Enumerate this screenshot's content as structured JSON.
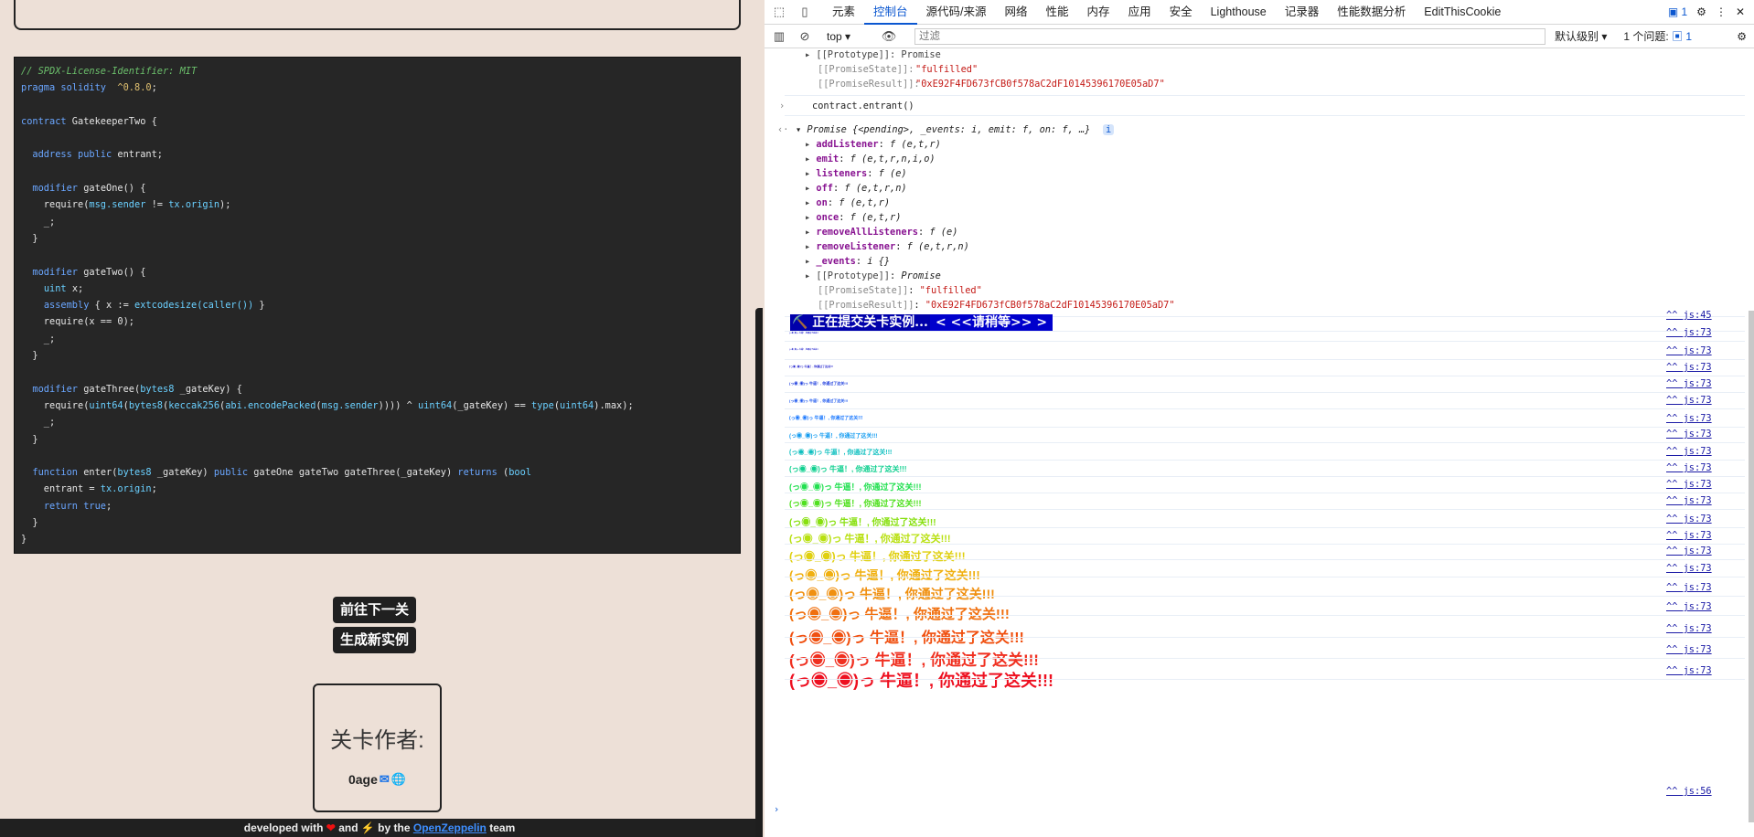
{
  "code": {
    "lines": [
      [
        [
          "cm",
          "// SPDX-License-Identifier: MIT"
        ]
      ],
      [
        [
          "kw",
          "pragma solidity"
        ],
        [
          "",
          "  "
        ],
        [
          "st",
          "^0.8.0"
        ],
        [
          "",
          ";"
        ]
      ],
      [
        [
          "",
          ""
        ]
      ],
      [
        [
          "kw",
          "contract"
        ],
        [
          "",
          " GatekeeperTwo {"
        ]
      ],
      [
        [
          "",
          ""
        ]
      ],
      [
        [
          "",
          "  "
        ],
        [
          "kw",
          "address public"
        ],
        [
          "",
          " entrant;"
        ]
      ],
      [
        [
          "",
          ""
        ]
      ],
      [
        [
          "",
          "  "
        ],
        [
          "kw",
          "modifier"
        ],
        [
          "",
          " gateOne() {"
        ]
      ],
      [
        [
          "",
          "    require("
        ],
        [
          "tp",
          "msg.sender"
        ],
        [
          "",
          " != "
        ],
        [
          "tp",
          "tx.origin"
        ],
        [
          "",
          ");"
        ]
      ],
      [
        [
          "",
          "    _;"
        ]
      ],
      [
        [
          "",
          "  }"
        ]
      ],
      [
        [
          "",
          ""
        ]
      ],
      [
        [
          "",
          "  "
        ],
        [
          "kw",
          "modifier"
        ],
        [
          "",
          " gateTwo() {"
        ]
      ],
      [
        [
          "",
          "    "
        ],
        [
          "tp",
          "uint"
        ],
        [
          "",
          " x;"
        ]
      ],
      [
        [
          "",
          "    "
        ],
        [
          "kw",
          "assembly"
        ],
        [
          "",
          " { x := "
        ],
        [
          "tp",
          "extcodesize(caller())"
        ],
        [
          "",
          " }"
        ]
      ],
      [
        [
          "",
          "    require(x == 0);"
        ]
      ],
      [
        [
          "",
          "    _;"
        ]
      ],
      [
        [
          "",
          "  }"
        ]
      ],
      [
        [
          "",
          ""
        ]
      ],
      [
        [
          "",
          "  "
        ],
        [
          "kw",
          "modifier"
        ],
        [
          "",
          " gateThree("
        ],
        [
          "tp",
          "bytes8"
        ],
        [
          "",
          " _gateKey) {"
        ]
      ],
      [
        [
          "",
          "    require("
        ],
        [
          "tp",
          "uint64"
        ],
        [
          "",
          "("
        ],
        [
          "tp",
          "bytes8"
        ],
        [
          "",
          "("
        ],
        [
          "tp",
          "keccak256"
        ],
        [
          "",
          "("
        ],
        [
          "tp",
          "abi.encodePacked"
        ],
        [
          "",
          "("
        ],
        [
          "tp",
          "msg.sender"
        ],
        [
          "",
          ")))) ^ "
        ],
        [
          "tp",
          "uint64"
        ],
        [
          "",
          "(_gateKey) == "
        ],
        [
          "tp",
          "type"
        ],
        [
          "",
          "("
        ],
        [
          "tp",
          "uint64"
        ],
        [
          "",
          ").max);"
        ]
      ],
      [
        [
          "",
          "    _;"
        ]
      ],
      [
        [
          "",
          "  }"
        ]
      ],
      [
        [
          "",
          ""
        ]
      ],
      [
        [
          "",
          "  "
        ],
        [
          "kw",
          "function"
        ],
        [
          "",
          " enter("
        ],
        [
          "tp",
          "bytes8"
        ],
        [
          "",
          " _gateKey) "
        ],
        [
          "kw",
          "public"
        ],
        [
          "",
          " gateOne gateTwo gateThree(_gateKey) "
        ],
        [
          "kw",
          "returns"
        ],
        [
          "",
          " ("
        ],
        [
          "tp",
          "bool"
        ],
        [
          ") {"
        ]
      ],
      [
        [
          "",
          "    entrant = "
        ],
        [
          "tp",
          "tx.origin"
        ],
        [
          "",
          ";"
        ]
      ],
      [
        [
          "",
          "    "
        ],
        [
          "kw",
          "return true"
        ],
        [
          "",
          ";"
        ]
      ],
      [
        [
          "",
          "  }"
        ]
      ],
      [
        [
          "",
          "}"
        ]
      ]
    ]
  },
  "buttons": {
    "next": "前往下一关",
    "new_instance": "生成新实例"
  },
  "author": {
    "title": "关卡作者:",
    "name": "0age"
  },
  "footer": {
    "pre": "developed with",
    "and": "and",
    "by": "by the",
    "link": "OpenZeppelin",
    "post": "team"
  },
  "devtools": {
    "tabs": [
      "元素",
      "控制台",
      "源代码/来源",
      "网络",
      "性能",
      "内存",
      "应用",
      "安全",
      "Lighthouse",
      "记录器",
      "性能数据分析",
      "EditThisCookie"
    ],
    "active_tab": "控制台",
    "issue_badge": "1",
    "context": "top",
    "filter_placeholder": "过滤",
    "level": "默认级别",
    "issues": "1 个问题:",
    "issues_count": "1"
  },
  "console": {
    "top_block": [
      "[[Prototype]]: Promise",
      "[[PromiseState]]: \"fulfilled\"",
      "[[PromiseResult]]: \"0xE92F4FD673fCB0f578aC2dF10145396170E05aD7\""
    ],
    "command": "contract.entrant()",
    "promise_header": "Promise  {<pending>, _events: i, emit: f, on: f, …}",
    "props": [
      {
        "k": "addListener",
        "v": "f (e,t,r)"
      },
      {
        "k": "emit",
        "v": "f (e,t,r,n,i,o)"
      },
      {
        "k": "listeners",
        "v": "f (e)"
      },
      {
        "k": "off",
        "v": "f (e,t,r,n)"
      },
      {
        "k": "on",
        "v": "f (e,t,r)"
      },
      {
        "k": "once",
        "v": "f (e,t,r)"
      },
      {
        "k": "removeAllListeners",
        "v": "f (e)"
      },
      {
        "k": "removeListener",
        "v": "f (e,t,r,n)"
      },
      {
        "k": "_events",
        "v": "i  {}"
      },
      {
        "k": "[[Prototype]]",
        "v": "Promise"
      },
      {
        "k": "[[PromiseState]]",
        "v": "\"fulfilled\""
      },
      {
        "k": "[[PromiseResult]]",
        "v": "\"0xE92F4FD673fCB0f578aC2dF10145396170E05aD7\""
      }
    ],
    "submit_msg_a": "⛏️ 正在提交关卡实例...",
    "submit_msg_b": "< <<请稍等>> >",
    "link_45": "^^ js:45",
    "link_73": "^^ js:73",
    "link_56": "^^ js:56",
    "success_text": "(っ◉_◉)っ 牛逼！, 你通过了这关!!!",
    "success_colors": [
      "#1b1bcc",
      "#1b1bcc",
      "#1b1bcc",
      "#1b3bdd",
      "#1a55ee",
      "#1877ff",
      "#149cf0",
      "#10c0c0",
      "#10d090",
      "#22e050",
      "#50e020",
      "#88e010",
      "#b8e010",
      "#e0d010",
      "#f0b010",
      "#f09010",
      "#f07010",
      "#f05010",
      "#f03020",
      "#ee1020"
    ],
    "success_sizes": [
      2,
      2,
      3,
      4,
      4,
      5,
      6,
      7,
      8,
      9,
      9,
      10,
      11,
      12,
      13,
      14,
      15,
      16,
      17,
      18
    ]
  }
}
